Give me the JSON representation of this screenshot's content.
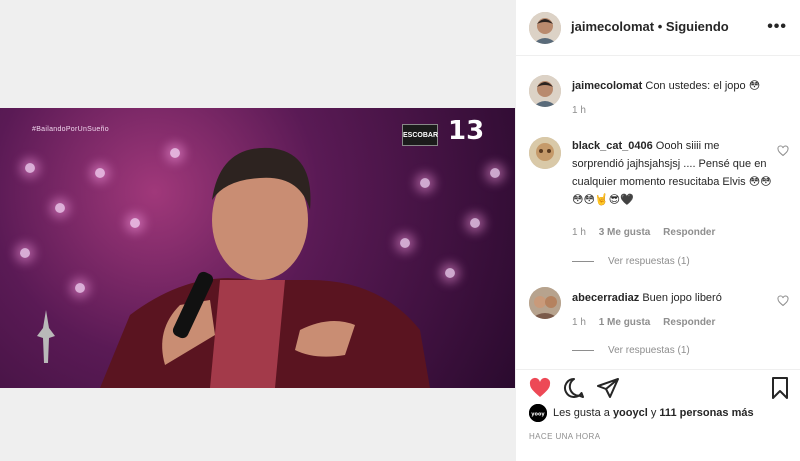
{
  "video": {
    "hashtag": "#BailandoPorUnSueño",
    "logo_text": "ESCOBAR",
    "channel": "13"
  },
  "post": {
    "username": "jaimecolomat",
    "separator": "•",
    "follow_status": "Siguiendo",
    "more_icon": "ellipsis-icon"
  },
  "caption": {
    "username": "jaimecolomat",
    "text": "Con ustedes: el jopo 😳",
    "time": "1 h"
  },
  "comments": [
    {
      "username": "black_cat_0406",
      "text": "Oooh siiii me sorprendió jajhsjahsjsj .... Pensé que en cualquier momento resucitaba Elvis 😳😳😳😳🤘😎🖤",
      "time": "1 h",
      "likes": "3 Me gusta",
      "reply": "Responder",
      "replies": "Ver respuestas (1)"
    },
    {
      "username": "abecerradiaz",
      "text": "Buen jopo liberó",
      "time": "1 h",
      "likes": "1 Me gusta",
      "reply": "Responder",
      "replies": "Ver respuestas (1)"
    }
  ],
  "actions": {
    "like_icon": "heart-filled-icon",
    "comment_icon": "comment-icon",
    "share_icon": "share-icon",
    "save_icon": "bookmark-icon",
    "like_color": "#ed4956"
  },
  "likes": {
    "prefix": "Les gusta a",
    "user": "yooycl",
    "conj": "y",
    "others": "111 personas más",
    "avatar_text": "yooy"
  },
  "timestamp": "HACE UNA HORA"
}
